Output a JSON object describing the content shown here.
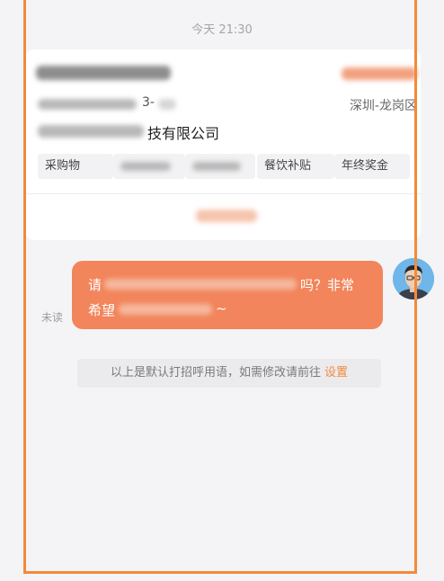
{
  "chat": {
    "timestamp": "今天 21:30",
    "unread_label": "未读"
  },
  "job_card": {
    "line2_visible_suffix": "3-",
    "location": "深圳-龙岗区",
    "company_visible_suffix": "技有限公司",
    "tags": [
      "采购物",
      "",
      "",
      "餐饮补贴",
      "年终奖金"
    ]
  },
  "message": {
    "line1_visible_start": "请",
    "line1_visible_end": "吗？非常",
    "line2_visible_start": "希望",
    "line2_visible_end": "~"
  },
  "notice": {
    "text": "以上是默认打招呼用语，如需修改请前往",
    "link": "设置"
  },
  "colors": {
    "accent": "#f28a3c",
    "bubble": "#f2855b",
    "background": "#f4f4f6"
  }
}
